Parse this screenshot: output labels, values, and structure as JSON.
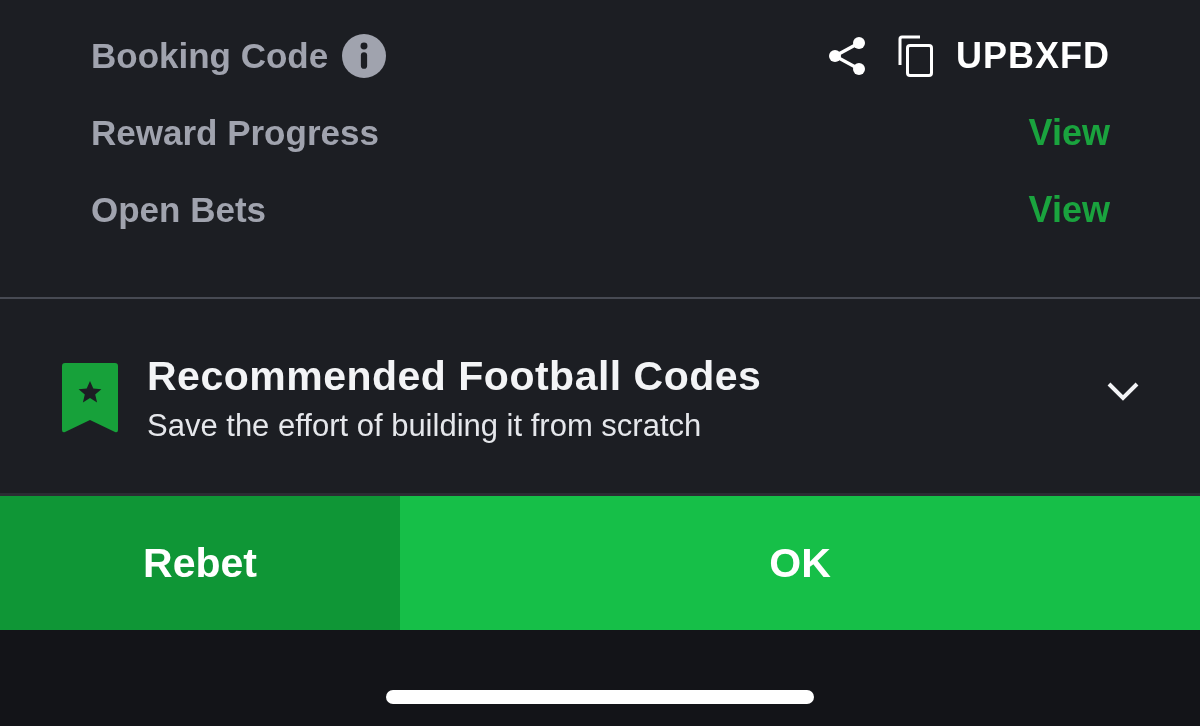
{
  "rows": [
    {
      "kind": "code",
      "label": "Booking Code",
      "code": "UPBXFD"
    },
    {
      "kind": "link",
      "label": "Reward Progress",
      "link": "View"
    },
    {
      "kind": "link",
      "label": "Open Bets",
      "link": "View"
    }
  ],
  "recommendation": {
    "title": "Recommended Football Codes",
    "subtitle": "Save the effort of building it from scratch",
    "expanded": false
  },
  "buttons": [
    {
      "kind": "secondary",
      "label": "Rebet"
    },
    {
      "kind": "primary",
      "label": "OK"
    }
  ]
}
